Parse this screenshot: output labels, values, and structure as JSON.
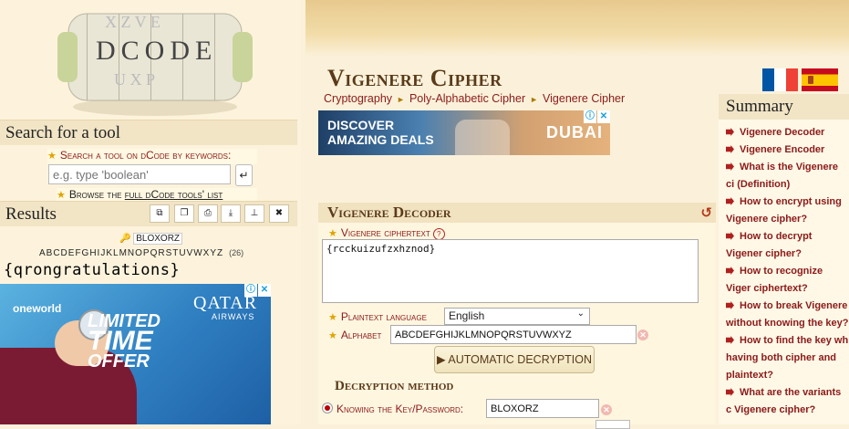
{
  "logo": {
    "text": "DCODE"
  },
  "search": {
    "title": "Search for a tool",
    "keywords_label": "Search a tool on dCode by keywords:",
    "placeholder": "e.g. type 'boolean'",
    "go_icon": "enter-icon",
    "browse_prefix": "Browse the ",
    "browse_link": "full dCode tools' list"
  },
  "results": {
    "title": "Results",
    "buttons": [
      "copy-icon",
      "clone-icon",
      "print-icon",
      "download-icon",
      "pin-icon",
      "close-icon"
    ],
    "key": "BLOXORZ",
    "alphabet": "ABCDEFGHIJKLMNOPQRSTUVWXYZ",
    "alphabet_count": "(26)",
    "plaintext": "{qrongratulations}"
  },
  "ad_left": {
    "brand": "oneworld",
    "airline": "QATAR",
    "airline_sub": "AIRWAYS",
    "slogan_1": "LIMITED",
    "slogan_2": "TIME",
    "slogan_3": "OFFER"
  },
  "page": {
    "title": "Vigenere Cipher",
    "breadcrumb": [
      "Cryptography",
      "Poly-Alphabetic Cipher",
      "Vigenere Cipher"
    ]
  },
  "ad_center": {
    "line1": "DISCOVER",
    "line2": "AMAZING DEALS",
    "brand": "DUBAI"
  },
  "decoder": {
    "title": "Vigenere Decoder",
    "ciphertext_label": "Vigenere ciphertext",
    "ciphertext": "{rcckuizufzxhznod}",
    "plaintext_language_label": "Plaintext language",
    "plaintext_language": "English",
    "alphabet_label": "Alphabet",
    "alphabet": "ABCDEFGHIJKLMNOPQRSTUVWXYZ",
    "auto_button": "AUTOMATIC DECRYPTION",
    "method_title": "Decryption method",
    "knowing_key_label": "Knowing the Key/Password:",
    "key_value": "BLOXORZ"
  },
  "flags": {
    "fr_colors": [
      "#0055a4",
      "#ffffff",
      "#ef4135"
    ]
  },
  "summary": {
    "title": "Summary",
    "items": [
      "Vigenere Decoder",
      "Vigenere Encoder",
      "What is the Vigenere ci (Definition)",
      "How to encrypt using Vigenere cipher?",
      "How to decrypt Vigener cipher?",
      "How to recognize Viger ciphertext?",
      "How to break Vigenere without knowing the key?",
      "How to find the key wh having both cipher and plaintext?",
      "What are the variants c Vigenere cipher?"
    ]
  }
}
